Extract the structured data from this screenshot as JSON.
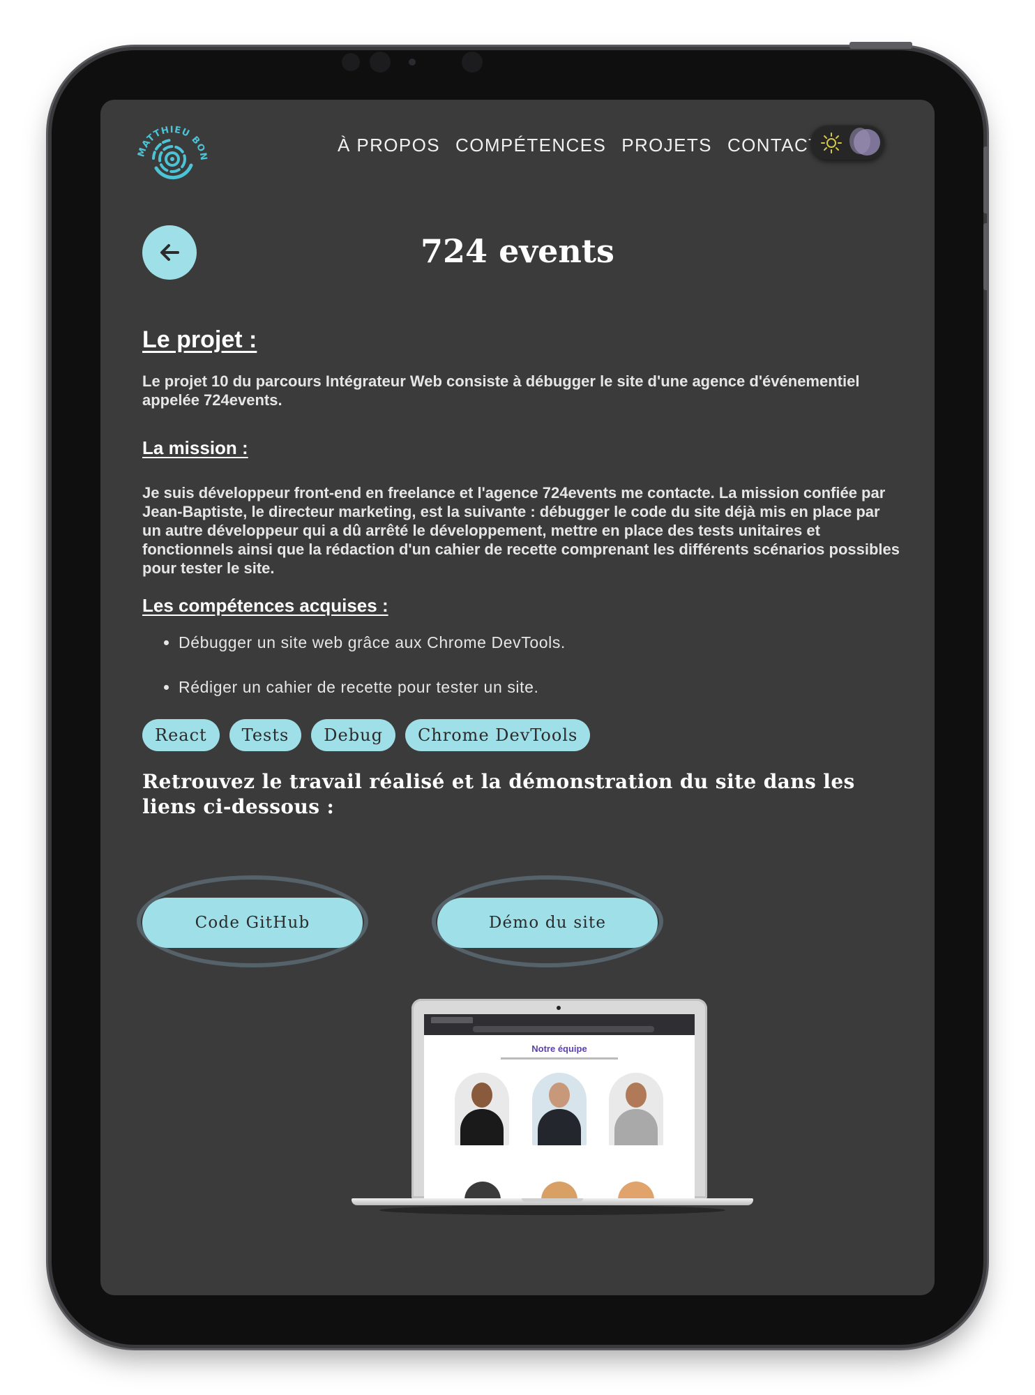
{
  "header": {
    "logo_text": "MATTHIEU BONJOUR",
    "nav": [
      "À PROPOS",
      "COMPÉTENCES",
      "PROJETS",
      "CONTACT"
    ],
    "theme_toggle": {
      "sun_icon": "sun-icon",
      "state": "dark"
    }
  },
  "project": {
    "title": "724 events",
    "project_heading": "Le projet :",
    "project_text": "Le projet 10 du parcours Intégrateur Web consiste à débugger le site d'une agence d'événementiel appelée 724events.",
    "mission_heading": "La mission :",
    "mission_text": "Je suis développeur front-end en freelance et l'agence 724events me contacte. La mission confiée par Jean-Baptiste, le directeur marketing, est la suivante : débugger le code du site déjà mis en place par un autre développeur qui a dû arrêté le développement, mettre en place des tests unitaires et fonctionnels ainsi que la rédaction d'un cahier de recette comprenant les différents scénarios possibles pour tester le site.",
    "skills_heading": "Les compétences acquises :",
    "skills": [
      "Débugger un site web grâce aux Chrome DevTools.",
      "Rédiger un cahier de recette pour tester un site."
    ],
    "tags": [
      "React",
      "Tests",
      "Debug",
      "Chrome DevTools"
    ],
    "links_intro": "Retrouvez le travail réalisé et la démonstration du site dans les liens ci-dessous :",
    "github_label": "Code GitHub",
    "demo_label": "Démo du site"
  },
  "preview": {
    "team_title": "Notre équipe"
  },
  "colors": {
    "accent": "#9fdfe7",
    "background": "#3b3b3b",
    "logo": "#4cc4d6"
  }
}
